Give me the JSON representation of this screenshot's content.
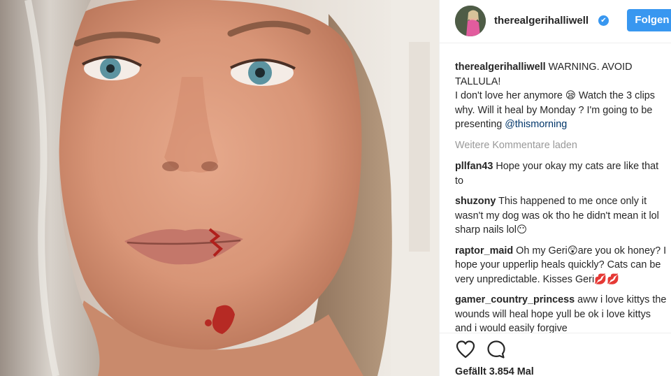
{
  "post": {
    "username": "therealgerihalliwell",
    "verified_mark": "✔",
    "follow_label": "Folgen",
    "load_more": "Weitere Kommentare laden",
    "likes": "Gefällt 3.854 Mal"
  },
  "caption": {
    "user": "therealgerihalliwell",
    "line1": " WARNING. AVOID TALLULA!",
    "line2": "I don't love her anymore 😪 Watch the 3 clips why. Will it heal by Monday ? I'm going to be presenting ",
    "mention": "@thismorning"
  },
  "comments": [
    {
      "user": "pllfan43",
      "text": " Hope your okay my cats are like that to"
    },
    {
      "user": "shuzony",
      "text": " This happened to me once only it wasn't my dog was ok tho he didn't mean it lol sharp nails lol😶"
    },
    {
      "user": "raptor_maid",
      "text": " Oh my Geri😲are you ok honey? I hope your upperlip heals quickly? Cats can be very unpredictable. Kisses Geri💋💋"
    },
    {
      "user": "gamer_country_princess",
      "text": " aww i love kittys the wounds will heal hope yull be ok i love kittys and i would easily forgive"
    }
  ],
  "icons": {
    "like": "heart-icon",
    "comment": "comment-bubble-icon",
    "verified": "verified-badge-icon"
  },
  "colors": {
    "accent": "#3897f0",
    "mention": "#003569",
    "muted": "#999999",
    "text": "#262626"
  }
}
